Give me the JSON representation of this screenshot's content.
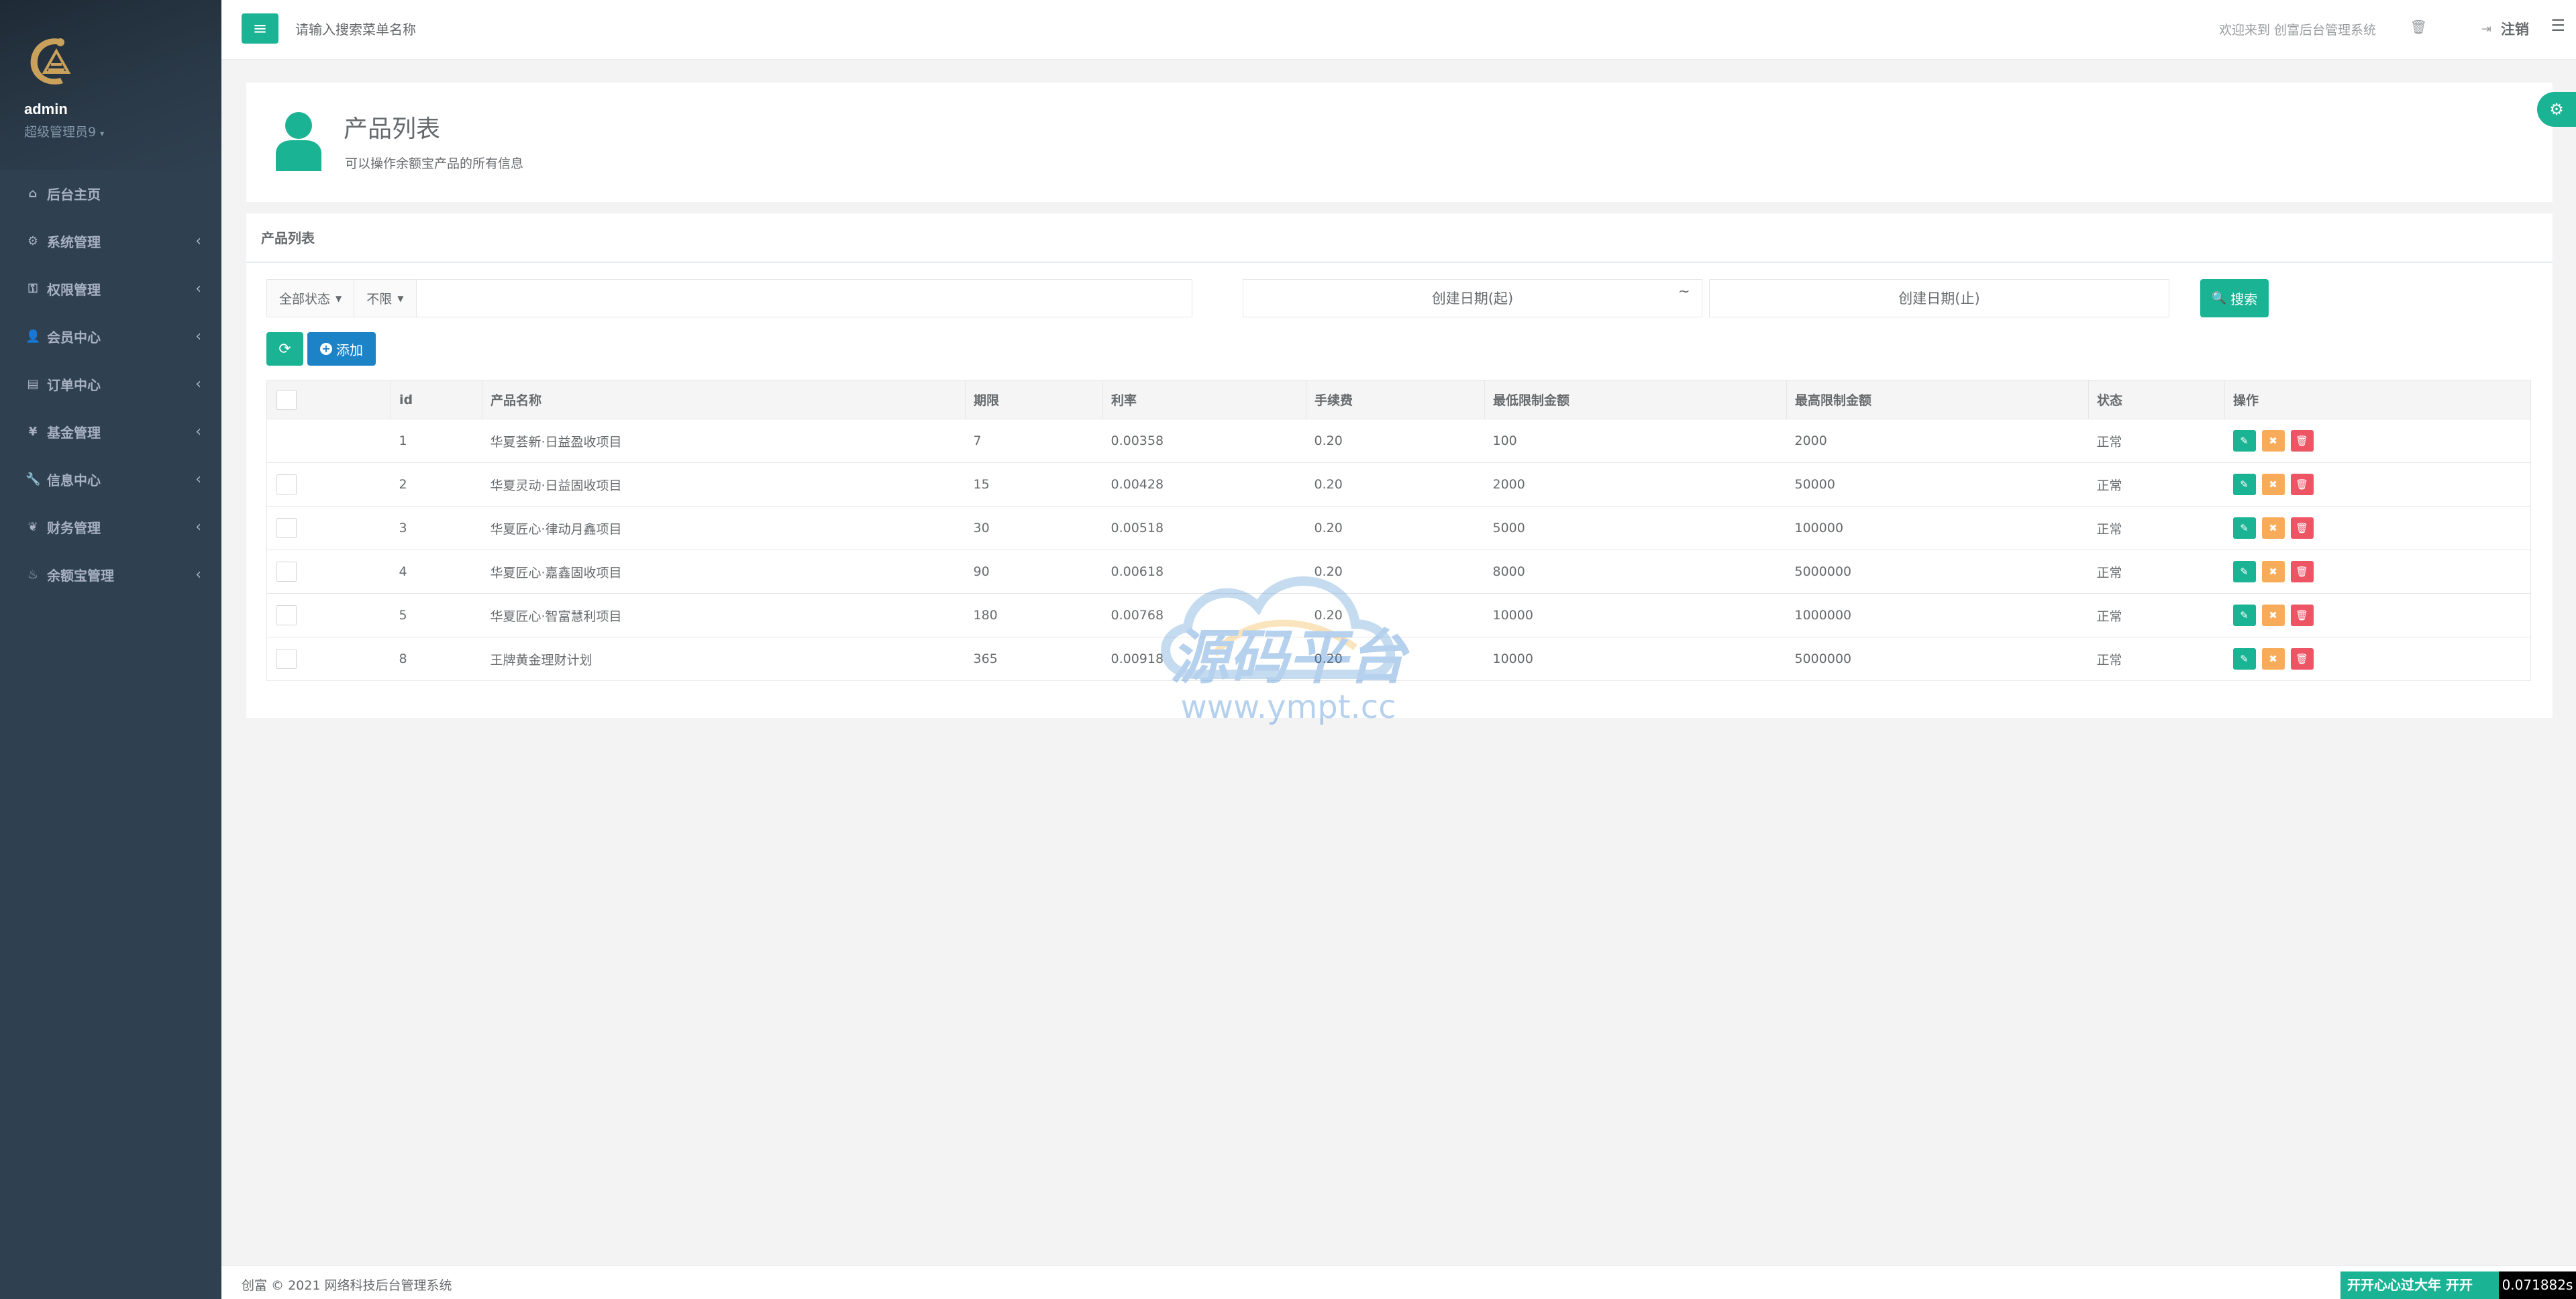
{
  "colors": {
    "sidebar_bg": "#2f4050",
    "primary": "#1ab394",
    "info": "#1c84c6",
    "warning": "#f8ac59",
    "danger": "#ed5565"
  },
  "sidebar": {
    "username": "admin",
    "role": "超级管理员9",
    "items": [
      {
        "label": "后台主页",
        "icon": "home-icon",
        "has_arrow": false
      },
      {
        "label": "系统管理",
        "icon": "cogs-icon",
        "has_arrow": true
      },
      {
        "label": "权限管理",
        "icon": "key-icon",
        "has_arrow": true
      },
      {
        "label": "会员中心",
        "icon": "user-icon",
        "has_arrow": true
      },
      {
        "label": "订单中心",
        "icon": "list-icon",
        "has_arrow": true
      },
      {
        "label": "基金管理",
        "icon": "yen-icon",
        "has_arrow": true
      },
      {
        "label": "信息中心",
        "icon": "wrench-icon",
        "has_arrow": true
      },
      {
        "label": "财务管理",
        "icon": "leaf-icon",
        "has_arrow": true
      },
      {
        "label": "余额宝管理",
        "icon": "fire-icon",
        "has_arrow": true
      }
    ]
  },
  "topbar": {
    "search_placeholder": "请输入搜索菜单名称",
    "welcome": "欢迎来到 创富后台管理系统",
    "logout": "注销"
  },
  "header": {
    "title": "产品列表",
    "subtitle": "可以操作余额宝产品的所有信息"
  },
  "panel": {
    "title": "产品列表",
    "status_filter": "全部状态",
    "limit_filter": "不限",
    "date_start_placeholder": "创建日期(起)",
    "date_sep": "~",
    "date_end_placeholder": "创建日期(止)",
    "search_label": "搜索",
    "add_label": "添加"
  },
  "table": {
    "columns": [
      "id",
      "产品名称",
      "期限",
      "利率",
      "手续费",
      "最低限制金额",
      "最高限制金额",
      "状态",
      "操作"
    ],
    "rows": [
      {
        "id": "1",
        "name": "华夏荟新·日益盈收项目",
        "term": "7",
        "rate": "0.00358",
        "fee": "0.20",
        "min": "100",
        "max": "2000",
        "status": "正常",
        "checkbox": false
      },
      {
        "id": "2",
        "name": "华夏灵动·日益固收项目",
        "term": "15",
        "rate": "0.00428",
        "fee": "0.20",
        "min": "2000",
        "max": "50000",
        "status": "正常",
        "checkbox": true
      },
      {
        "id": "3",
        "name": "华夏匠心·律动月鑫项目",
        "term": "30",
        "rate": "0.00518",
        "fee": "0.20",
        "min": "5000",
        "max": "100000",
        "status": "正常",
        "checkbox": true
      },
      {
        "id": "4",
        "name": "华夏匠心·嘉鑫固收项目",
        "term": "90",
        "rate": "0.00618",
        "fee": "0.20",
        "min": "8000",
        "max": "5000000",
        "status": "正常",
        "checkbox": true
      },
      {
        "id": "5",
        "name": "华夏匠心·智富慧利项目",
        "term": "180",
        "rate": "0.00768",
        "fee": "0.20",
        "min": "10000",
        "max": "1000000",
        "status": "正常",
        "checkbox": true
      },
      {
        "id": "8",
        "name": "王牌黄金理财计划",
        "term": "365",
        "rate": "0.00918",
        "fee": "0.20",
        "min": "10000",
        "max": "5000000",
        "status": "正常",
        "checkbox": true
      }
    ]
  },
  "watermark": {
    "text": "源码平台",
    "url": "www.ympt.cc"
  },
  "footer": {
    "text": "创富 © 2021 网络科技后台管理系统",
    "ticker": "开开心心过大年 开开",
    "timer": "0.071882s"
  }
}
